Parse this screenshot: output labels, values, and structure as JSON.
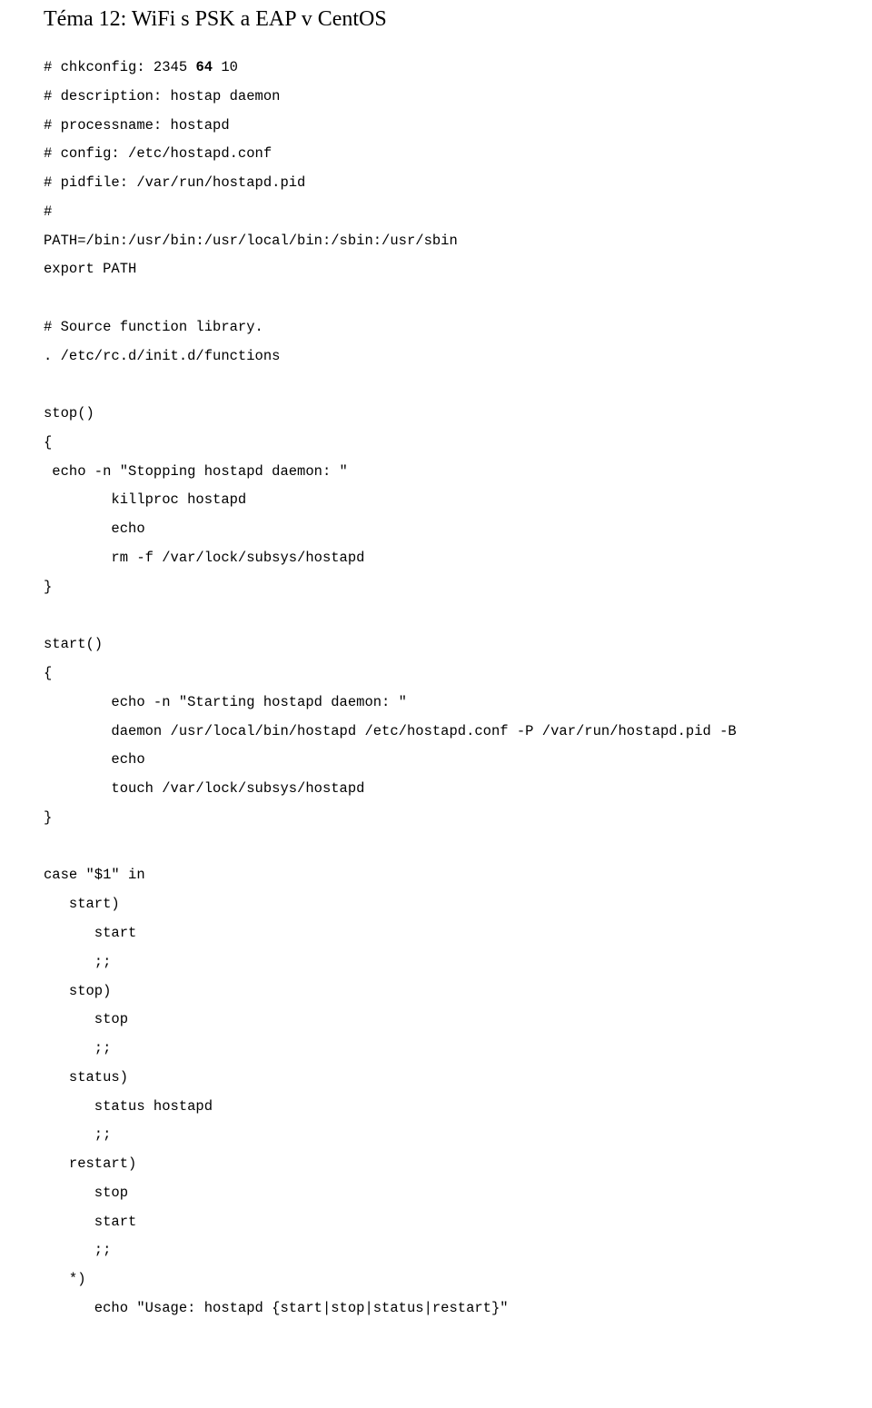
{
  "title": "Téma 12: WiFi s PSK a EAP v CentOS",
  "lines": {
    "l0": "# chkconfig: 2345 ",
    "l0b": "64",
    "l0c": " 10",
    "l1": "# description: hostap daemon",
    "l2": "# processname: hostapd",
    "l3": "# config: /etc/hostapd.conf",
    "l4": "# pidfile: /var/run/hostapd.pid",
    "l5": "#",
    "l6": "PATH=/bin:/usr/bin:/usr/local/bin:/sbin:/usr/sbin",
    "l7": "export PATH",
    "l8": "# Source function library.",
    "l9": ". /etc/rc.d/init.d/functions",
    "l10": "stop()",
    "l11": "{",
    "l12": " echo -n \"Stopping hostapd daemon: \"",
    "l13": "        killproc hostapd",
    "l14": "        echo",
    "l15": "        rm -f /var/lock/subsys/hostapd",
    "l16": "}",
    "l17": "start()",
    "l18": "{",
    "l19": "        echo -n \"Starting hostapd daemon: \"",
    "l20": "        daemon /usr/local/bin/hostapd /etc/hostapd.conf -P /var/run/hostapd.pid -B",
    "l21": "        echo",
    "l22": "        touch /var/lock/subsys/hostapd",
    "l23": "}",
    "l24": "case \"$1\" in",
    "l25": "   start)",
    "l26": "      start",
    "l27": "      ;;",
    "l28": "   stop)",
    "l29": "      stop",
    "l30": "      ;;",
    "l31": "   status)",
    "l32": "      status hostapd",
    "l33": "      ;;",
    "l34": "   restart)",
    "l35": "      stop",
    "l36": "      start",
    "l37": "      ;;",
    "l38": "   *)",
    "l39": "      echo \"Usage: hostapd {start|stop|status|restart}\""
  }
}
